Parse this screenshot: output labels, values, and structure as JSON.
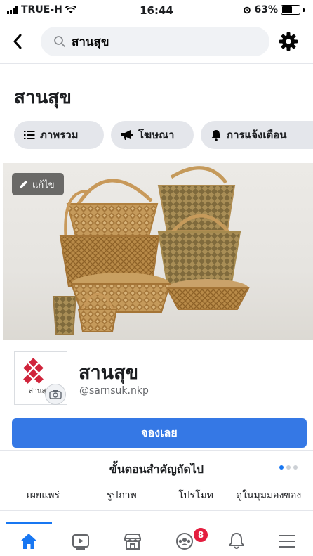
{
  "status_bar": {
    "carrier": "TRUE-H",
    "time": "16:44",
    "battery": "63%",
    "battery_level": 0.63
  },
  "search": {
    "query": "สานสุข"
  },
  "page_heading": "สานสุข",
  "chips": [
    {
      "label": "ภาพรวม",
      "icon": "list-icon"
    },
    {
      "label": "โฆษณา",
      "icon": "megaphone-icon"
    },
    {
      "label": "การแจ้งเตือน",
      "icon": "bell-icon"
    }
  ],
  "cover": {
    "edit_label": "แก้ไข"
  },
  "profile": {
    "name": "สานสุข",
    "handle": "@sarnsuk.nkp",
    "logo_text": "สานสุ"
  },
  "book_button": "จองเลย",
  "next_steps": {
    "title": "ขั้นตอนสำคัญถัดไป",
    "steps": [
      "เผยแพร่",
      "รูปภาพ",
      "โปรโมท",
      "ดูในมุมมองของ"
    ]
  },
  "bottom_nav": {
    "items": [
      "home-icon",
      "watch-icon",
      "marketplace-icon",
      "groups-icon",
      "notifications-icon",
      "menu-icon"
    ],
    "groups_badge": "8",
    "accent": "#1877f2"
  }
}
